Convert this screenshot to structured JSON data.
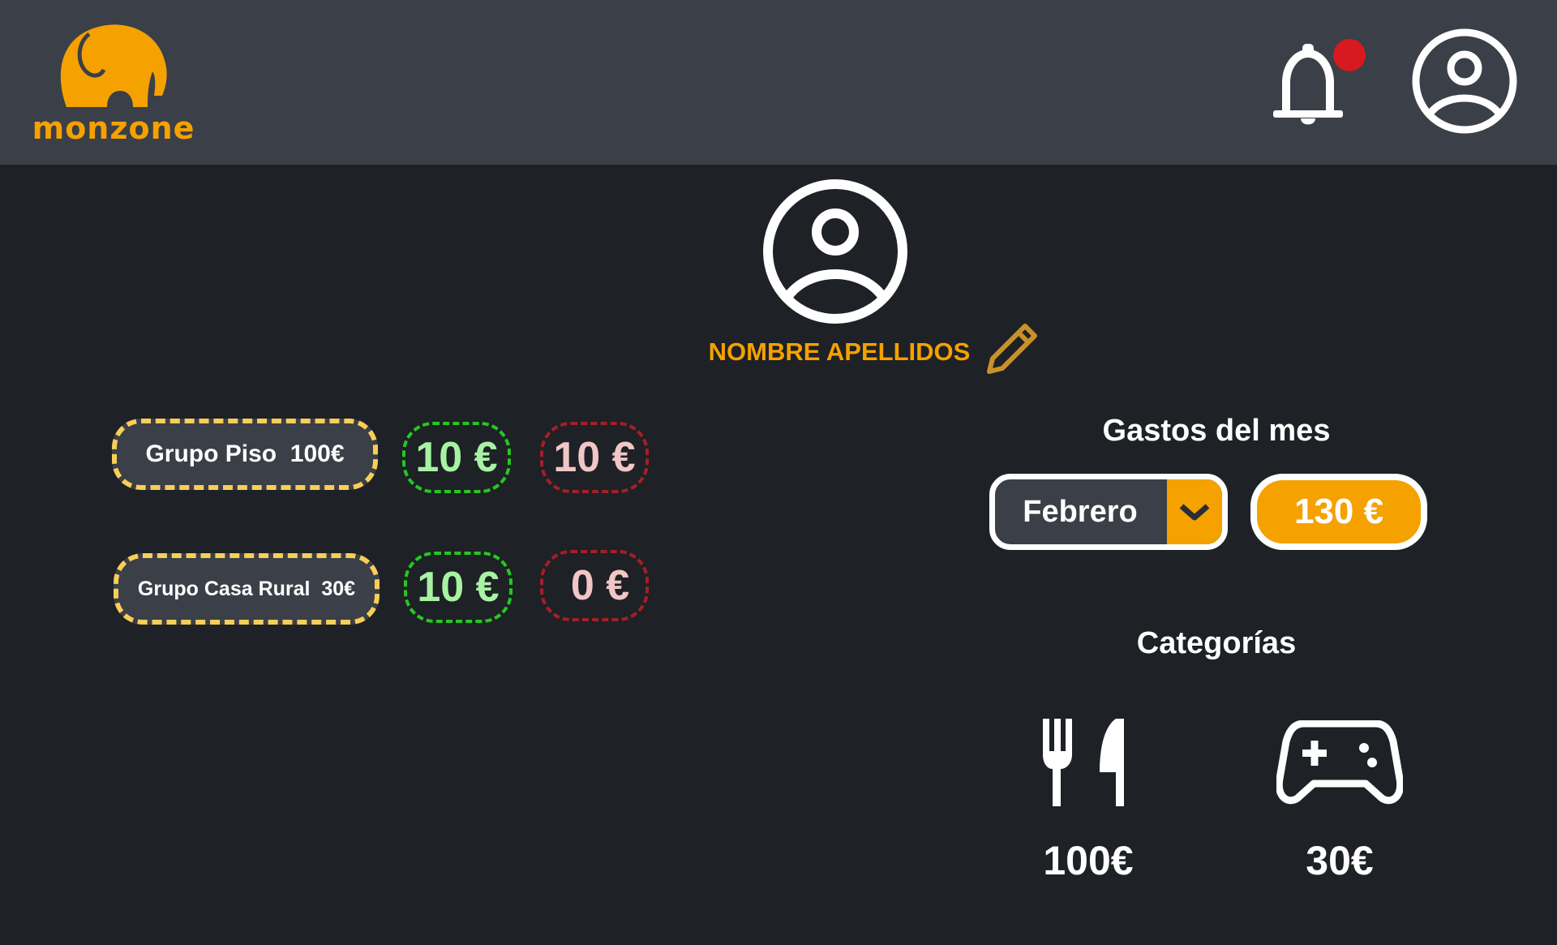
{
  "app": {
    "logo_text": "monzone",
    "brand_color": "#f5a100",
    "notification_badge_color": "#d71920"
  },
  "header": {
    "notification_icon": "bell-icon",
    "account_icon": "user-circle-icon"
  },
  "profile": {
    "avatar_icon": "user-circle-icon",
    "name": "NOMBRE APELLIDOS",
    "edit_icon": "pencil-icon"
  },
  "groups": [
    {
      "label": "Grupo Piso  100€",
      "credit": "10 €",
      "debt": "10 €"
    },
    {
      "label": "Grupo Casa Rural  30€",
      "credit": "10 €",
      "debt": "0 €"
    }
  ],
  "monthly": {
    "title": "Gastos del mes",
    "selected_month": "Febrero",
    "total": "130 €"
  },
  "categories": {
    "title": "Categorías",
    "items": [
      {
        "icon": "fork-knife-icon",
        "amount": "100€"
      },
      {
        "icon": "gamepad-icon",
        "amount": "30€"
      }
    ]
  }
}
